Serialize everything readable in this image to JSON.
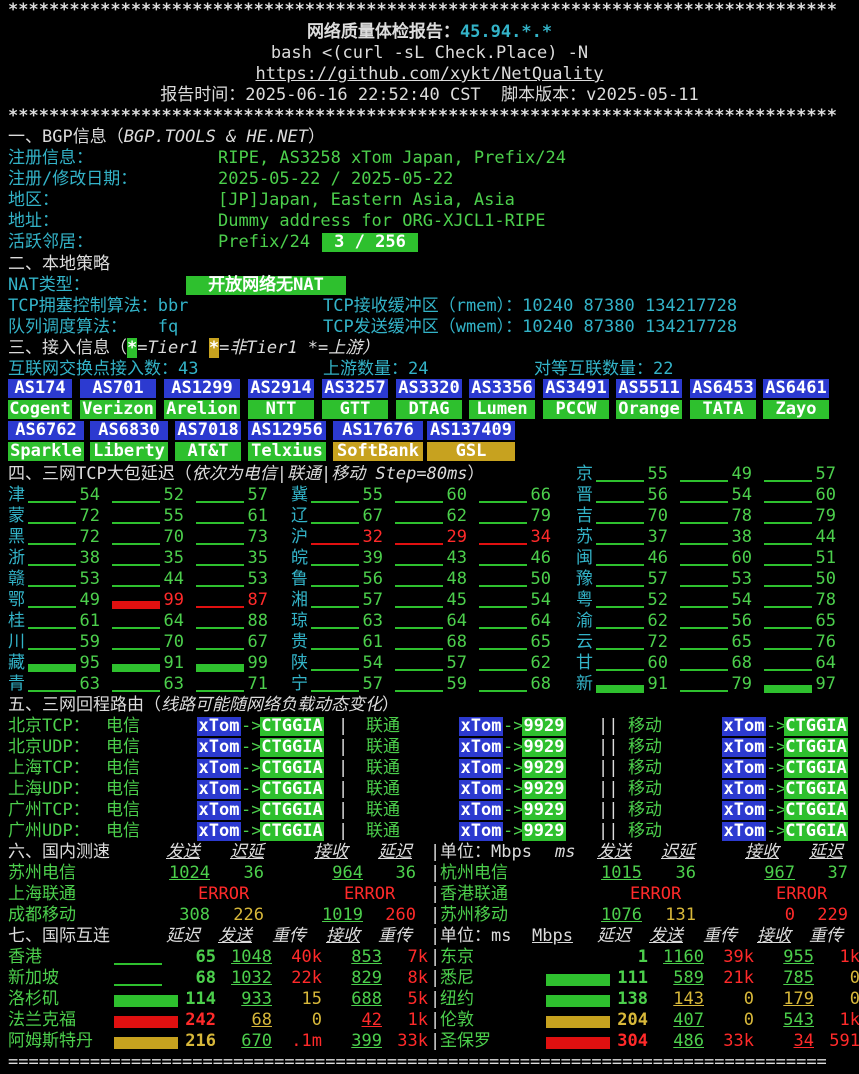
{
  "header": {
    "stars": "*********************************************************************************",
    "title": "网络质量体检报告：",
    "ip": "45.94.*.*",
    "command": "bash <(curl -sL Check.Place) -N",
    "url": "https://github.com/xykt/NetQuality",
    "report_time": "报告时间：2025-06-16 22:52:40 CST  脚本版本：v2025-05-11"
  },
  "bgp": {
    "heading": "一、BGP信息（",
    "heading_src": "BGP.TOOLS & HE.NET",
    "heading_end": "）",
    "rows": [
      {
        "label": "注册信息：",
        "value": "RIPE, AS3258 xTom Japan, Prefix/24"
      },
      {
        "label": "注册/修改日期：",
        "value": "2025-05-22 / 2025-05-22"
      },
      {
        "label": "地区：",
        "value": "[JP]Japan, Eastern Asia, Asia"
      },
      {
        "label": "地址：",
        "value": "Dummy address for ORG-XJCL1-RIPE"
      },
      {
        "label": "活跃邻居：",
        "value": "Prefix/24 ",
        "badge": " 3 / 256 "
      }
    ]
  },
  "local": {
    "heading": "二、本地策略",
    "nat_label": "NAT类型：",
    "nat_value": "开放网络无NAT",
    "cc_label": "TCP拥塞控制算法：bbr",
    "rmem": "TCP接收缓冲区（rmem）：10240 87380 134217728",
    "qd_label": "队列调度算法：   fq",
    "wmem": "TCP发送缓冲区（wmem）：10240 87380 134217728"
  },
  "access": {
    "heading": "三、接入信息（",
    "legend_a": "=Tier1 ",
    "legend_b": "=非Tier1 *=上游）",
    "star": "*",
    "ix_label": "互联网交换点接入数：43",
    "upstream_label": "上游数量：24",
    "peer_label": "对等互联数量：22",
    "row1": [
      {
        "as": "AS174",
        "name": "Cogent",
        "t": "g"
      },
      {
        "as": "AS701",
        "name": "Verizon",
        "t": "g"
      },
      {
        "as": "AS1299",
        "name": "Arelion",
        "t": "g"
      },
      {
        "as": "AS2914",
        "name": "NTT",
        "t": "g"
      },
      {
        "as": "AS3257",
        "name": "GTT",
        "t": "g"
      },
      {
        "as": "AS3320",
        "name": "DTAG",
        "t": "g"
      },
      {
        "as": "AS3356",
        "name": "Lumen",
        "t": "g"
      },
      {
        "as": "AS3491",
        "name": "PCCW",
        "t": "g"
      },
      {
        "as": "AS5511",
        "name": "Orange",
        "t": "g"
      },
      {
        "as": "AS6453",
        "name": "TATA",
        "t": "g"
      },
      {
        "as": "AS6461",
        "name": "Zayo",
        "t": "g"
      }
    ],
    "row2": [
      {
        "as": "AS6762",
        "name": "Sparkle",
        "t": "g"
      },
      {
        "as": "AS6830",
        "name": "Liberty",
        "t": "g"
      },
      {
        "as": "AS7018",
        "name": "AT&T",
        "t": "g"
      },
      {
        "as": "AS12956",
        "name": "Telxius",
        "t": "g"
      },
      {
        "as": "AS17676",
        "name": "SoftBank",
        "t": "y"
      },
      {
        "as": "AS137409",
        "name": "GSL",
        "t": "y"
      }
    ]
  },
  "latency": {
    "heading": "四、三网TCP大包延迟（",
    "heading_note": "依次为电信|联通|移动 Step=80ms",
    "heading_end": "）",
    "provinces": [
      {
        "p": "京",
        "v": [
          "55",
          "49",
          "57"
        ],
        "s": [
          "g",
          "g",
          "g"
        ]
      },
      {
        "p": "津",
        "v": [
          "54",
          "52",
          "57"
        ],
        "s": [
          "g",
          "g",
          "g"
        ]
      },
      {
        "p": "冀",
        "v": [
          "55",
          "60",
          "66"
        ],
        "s": [
          "g",
          "g",
          "g"
        ]
      },
      {
        "p": "晋",
        "v": [
          "56",
          "54",
          "60"
        ],
        "s": [
          "g",
          "g",
          "g"
        ]
      },
      {
        "p": "蒙",
        "v": [
          "72",
          "55",
          "61"
        ],
        "s": [
          "g",
          "g",
          "g"
        ]
      },
      {
        "p": "辽",
        "v": [
          "67",
          "62",
          "79"
        ],
        "s": [
          "g",
          "g",
          "g"
        ]
      },
      {
        "p": "吉",
        "v": [
          "70",
          "78",
          "79"
        ],
        "s": [
          "g",
          "g",
          "g"
        ]
      },
      {
        "p": "黑",
        "v": [
          "72",
          "70",
          "73"
        ],
        "s": [
          "g",
          "g",
          "g"
        ]
      },
      {
        "p": "沪",
        "v": [
          "32",
          "29",
          "34"
        ],
        "s": [
          "r",
          "r",
          "r"
        ]
      },
      {
        "p": "苏",
        "v": [
          "37",
          "38",
          "44"
        ],
        "s": [
          "g",
          "g",
          "g"
        ]
      },
      {
        "p": "浙",
        "v": [
          "38",
          "35",
          "35"
        ],
        "s": [
          "g",
          "g",
          "g"
        ]
      },
      {
        "p": "皖",
        "v": [
          "39",
          "43",
          "46"
        ],
        "s": [
          "g",
          "g",
          "g"
        ]
      },
      {
        "p": "闽",
        "v": [
          "46",
          "60",
          "51"
        ],
        "s": [
          "g",
          "g",
          "g"
        ]
      },
      {
        "p": "赣",
        "v": [
          "53",
          "44",
          "53"
        ],
        "s": [
          "g",
          "g",
          "g"
        ]
      },
      {
        "p": "鲁",
        "v": [
          "56",
          "48",
          "50"
        ],
        "s": [
          "g",
          "g",
          "g"
        ]
      },
      {
        "p": "豫",
        "v": [
          "57",
          "53",
          "50"
        ],
        "s": [
          "g",
          "g",
          "g"
        ]
      },
      {
        "p": "鄂",
        "v": [
          "49",
          "99",
          "87"
        ],
        "s": [
          "g",
          "r",
          "r"
        ]
      },
      {
        "p": "湘",
        "v": [
          "57",
          "45",
          "54"
        ],
        "s": [
          "g",
          "g",
          "g"
        ]
      },
      {
        "p": "粤",
        "v": [
          "52",
          "54",
          "78"
        ],
        "s": [
          "g",
          "g",
          "g"
        ]
      },
      {
        "p": "桂",
        "v": [
          "61",
          "64",
          "88"
        ],
        "s": [
          "g",
          "g",
          "g"
        ]
      },
      {
        "p": "琼",
        "v": [
          "63",
          "64",
          "64"
        ],
        "s": [
          "g",
          "g",
          "g"
        ]
      },
      {
        "p": "渝",
        "v": [
          "62",
          "56",
          "65"
        ],
        "s": [
          "g",
          "g",
          "g"
        ]
      },
      {
        "p": "川",
        "v": [
          "59",
          "70",
          "67"
        ],
        "s": [
          "g",
          "g",
          "g"
        ]
      },
      {
        "p": "贵",
        "v": [
          "61",
          "68",
          "65"
        ],
        "s": [
          "g",
          "g",
          "g"
        ]
      },
      {
        "p": "云",
        "v": [
          "72",
          "65",
          "76"
        ],
        "s": [
          "g",
          "g",
          "g"
        ]
      },
      {
        "p": "藏",
        "v": [
          "95",
          "91",
          "99"
        ],
        "s": [
          "g",
          "g",
          "g"
        ]
      },
      {
        "p": "陕",
        "v": [
          "54",
          "57",
          "62"
        ],
        "s": [
          "g",
          "g",
          "g"
        ]
      },
      {
        "p": "甘",
        "v": [
          "60",
          "68",
          "64"
        ],
        "s": [
          "g",
          "g",
          "g"
        ]
      },
      {
        "p": "青",
        "v": [
          "63",
          "63",
          "71"
        ],
        "s": [
          "g",
          "g",
          "g"
        ]
      },
      {
        "p": "宁",
        "v": [
          "57",
          "59",
          "68"
        ],
        "s": [
          "g",
          "g",
          "g"
        ]
      },
      {
        "p": "新",
        "v": [
          "91",
          "79",
          "97"
        ],
        "s": [
          "g",
          "g",
          "g"
        ]
      }
    ]
  },
  "routes": {
    "heading": "五、三网回程路由（",
    "heading_note": "线路可能随网络负载动态变化",
    "heading_end": "）",
    "isp": [
      "电信",
      "联通",
      "移动"
    ],
    "rows": [
      {
        "label": "北京TCP：",
        "hops": [
          [
            "xTom",
            "CTGGIA"
          ],
          [
            "xTom",
            "9929"
          ],
          [
            "xTom",
            "CTGGIA"
          ]
        ]
      },
      {
        "label": "北京UDP：",
        "hops": [
          [
            "xTom",
            "CTGGIA"
          ],
          [
            "xTom",
            "9929"
          ],
          [
            "xTom",
            "CTGGIA"
          ]
        ]
      },
      {
        "label": "上海TCP：",
        "hops": [
          [
            "xTom",
            "CTGGIA"
          ],
          [
            "xTom",
            "9929"
          ],
          [
            "xTom",
            "CTGGIA"
          ]
        ]
      },
      {
        "label": "上海UDP：",
        "hops": [
          [
            "xTom",
            "CTGGIA"
          ],
          [
            "xTom",
            "9929"
          ],
          [
            "xTom",
            "CTGGIA"
          ]
        ]
      },
      {
        "label": "广州TCP：",
        "hops": [
          [
            "xTom",
            "CTGGIA"
          ],
          [
            "xTom",
            "9929"
          ],
          [
            "xTom",
            "CTGGIA"
          ]
        ]
      },
      {
        "label": "广州UDP：",
        "hops": [
          [
            "xTom",
            "CTGGIA"
          ],
          [
            "xTom",
            "9929"
          ],
          [
            "xTom",
            "CTGGIA"
          ]
        ]
      }
    ]
  },
  "domestic": {
    "heading": "六、国内测速",
    "cols": [
      "发送",
      "迟延",
      "接收",
      "延迟"
    ],
    "unit": "单位：Mbps ",
    "unit_ms": "ms",
    "left": [
      {
        "name": "苏州电信",
        "send": "1024",
        "d1": "36",
        "recv": "964",
        "d2": "36"
      },
      {
        "name": "上海联通",
        "error": "ERROR"
      },
      {
        "name": "成都移动",
        "send": "308",
        "d1": "226",
        "recv": "1019",
        "d2": "260"
      }
    ],
    "right": [
      {
        "name": "杭州电信",
        "send": "1015",
        "d1": "36",
        "recv": "967",
        "d2": "37"
      },
      {
        "name": "香港联通",
        "error": "ERROR"
      },
      {
        "name": "苏州移动",
        "send": "1076",
        "d1": "131",
        "recv": "0",
        "d2": "229"
      }
    ]
  },
  "intl": {
    "heading": "七、国际互连",
    "cols": [
      "延迟",
      "发送",
      "重传",
      "接收",
      "重传"
    ],
    "unit": "单位：ms ",
    "unit_mbps": "Mbps",
    "left": [
      {
        "name": "香港",
        "lat": "65",
        "send": "1048",
        "rt1": "40k",
        "recv": "853",
        "rt2": "7k"
      },
      {
        "name": "新加坡",
        "lat": "68",
        "send": "1032",
        "rt1": "22k",
        "recv": "829",
        "rt2": "8k"
      },
      {
        "name": "洛杉矶",
        "lat": "114",
        "send": "933",
        "rt1": "15",
        "recv": "688",
        "rt2": "5k"
      },
      {
        "name": "法兰克福",
        "lat": "242",
        "send": "68",
        "rt1": "0",
        "recv": "42",
        "rt2": "1k"
      },
      {
        "name": "阿姆斯特丹",
        "lat": "216",
        "send": "670",
        "rt1": ".1m",
        "recv": "399",
        "rt2": "33k"
      }
    ],
    "right": [
      {
        "name": "东京",
        "lat": "1",
        "send": "1160",
        "rt1": "39k",
        "recv": "955",
        "rt2": "1k"
      },
      {
        "name": "悉尼",
        "lat": "111",
        "send": "589",
        "rt1": "21k",
        "recv": "785",
        "rt2": "0"
      },
      {
        "name": "纽约",
        "lat": "138",
        "send": "143",
        "rt1": "0",
        "recv": "179",
        "rt2": "0"
      },
      {
        "name": "伦敦",
        "lat": "204",
        "send": "407",
        "rt1": "0",
        "recv": "543",
        "rt2": "1k"
      },
      {
        "name": "圣保罗",
        "lat": "304",
        "send": "486",
        "rt1": "33k",
        "recv": "34",
        "rt2": "591"
      }
    ]
  },
  "footer": {
    "rule": "================================================================================"
  }
}
